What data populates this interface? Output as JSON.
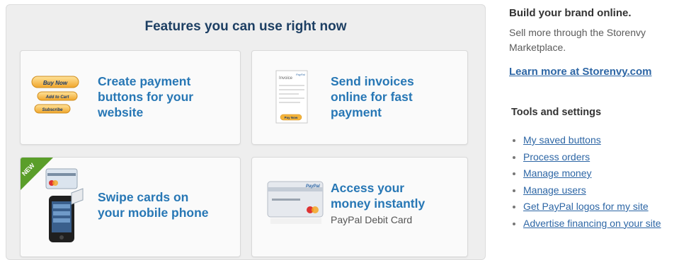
{
  "features": {
    "title": "Features you can use right now",
    "cards": [
      {
        "title": "Create payment\nbuttons for your\nwebsite",
        "icon": "paypal-buttons-illustration",
        "buttons": [
          "Buy Now",
          "Add to Cart",
          "Subscribe"
        ]
      },
      {
        "title": "Send invoices\nonline for fast\npayment",
        "icon": "invoice-illustration",
        "invoice_label": "Invoice",
        "brand": "PayPal",
        "pay_label": "Pay Now"
      },
      {
        "title": "Swipe cards on\nyour mobile phone",
        "icon": "mobile-card-reader-illustration",
        "badge": "NEW"
      },
      {
        "title": "Access your\nmoney instantly",
        "subtitle": "PayPal Debit Card",
        "icon": "debit-card-illustration",
        "brand": "PayPal"
      }
    ]
  },
  "sidebar": {
    "heading": "Build your brand online.",
    "text": "Sell more through the Storenvy Marketplace.",
    "link": "Learn more at Storenvy.com",
    "tools_heading": "Tools and settings",
    "tools": [
      "My saved buttons",
      "Process orders",
      "Manage money",
      "Manage users",
      "Get PayPal logos for my site",
      "Advertise financing on your site"
    ]
  },
  "colors": {
    "title": "#1d3f63",
    "card_title": "#2777b5",
    "link": "#2d66a5",
    "button_gold": "#f5b43a",
    "badge_green": "#5a9e2a"
  }
}
